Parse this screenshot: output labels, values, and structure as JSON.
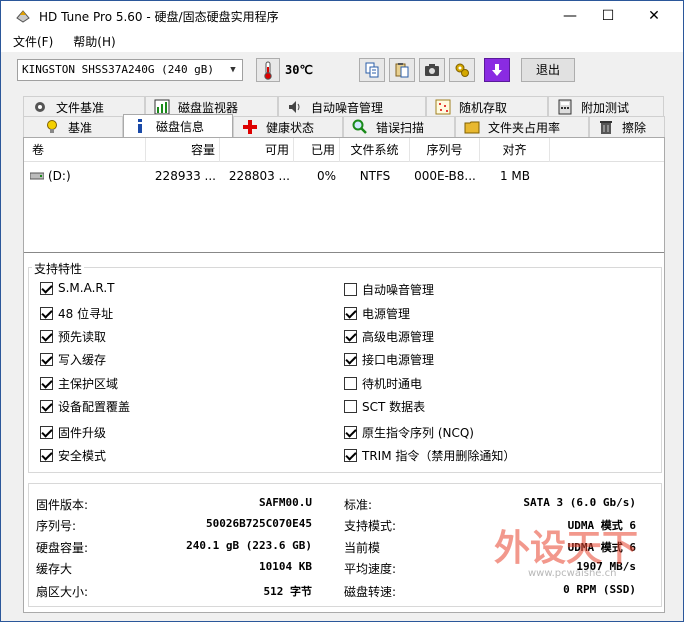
{
  "window": {
    "title": "HD Tune Pro 5.60 - 硬盘/固态硬盘实用程序",
    "minimize": "—",
    "maximize": "☐",
    "close": "✕"
  },
  "menu": {
    "file": "文件(F)",
    "help": "帮助(H)"
  },
  "toolbar": {
    "drive": "KINGSTON SHSS37A240G (240 gB)",
    "temperature": "30℃",
    "exit_label": "退出",
    "accent_color": "#8a2be2"
  },
  "tabs_top": [
    "文件基准",
    "磁盘监视器",
    "自动噪音管理",
    "随机存取",
    "附加测试"
  ],
  "tabs_bottom": [
    "基准",
    "磁盘信息",
    "健康状态",
    "错误扫描",
    "文件夹占用率",
    "擦除"
  ],
  "volumes": {
    "headers": [
      "卷",
      "容量",
      "可用",
      "已用",
      "文件系统",
      "序列号",
      "对齐"
    ],
    "rows": [
      {
        "vol": "(D:)",
        "capacity": "228933 ...",
        "free": "228803 ...",
        "used": "0%",
        "fs": "NTFS",
        "serial": "000E-B8...",
        "align": "1 MB"
      }
    ]
  },
  "features": {
    "title": "支持特性",
    "left": [
      {
        "label": "S.M.A.R.T",
        "checked": true
      },
      {
        "label": "48 位寻址",
        "checked": true
      },
      {
        "label": "预先读取",
        "checked": true
      },
      {
        "label": "写入缓存",
        "checked": true
      },
      {
        "label": "主保护区域",
        "checked": true
      },
      {
        "label": "设备配置覆盖",
        "checked": true
      },
      {
        "label": "固件升级",
        "checked": true
      },
      {
        "label": "安全模式",
        "checked": true
      }
    ],
    "right": [
      {
        "label": "自动噪音管理",
        "checked": false
      },
      {
        "label": "电源管理",
        "checked": true
      },
      {
        "label": "高级电源管理",
        "checked": true
      },
      {
        "label": "接口电源管理",
        "checked": true
      },
      {
        "label": "待机时通电",
        "checked": false
      },
      {
        "label": "SCT 数据表",
        "checked": false
      },
      {
        "label": "原生指令序列 (NCQ)",
        "checked": true
      },
      {
        "label": "TRIM 指令（禁用删除通知）",
        "checked": true
      }
    ]
  },
  "info": {
    "left": [
      {
        "label": "固件版本:",
        "value": "SAFM00.U"
      },
      {
        "label": "序列号:",
        "value": "50026B725C070E45"
      },
      {
        "label": "硬盘容量:",
        "value": "240.1 gB (223.6 GB)"
      },
      {
        "label": "缓存大",
        "value": "10104 KB"
      },
      {
        "label": "扇区大小:",
        "value": "512 字节"
      }
    ],
    "right": [
      {
        "label": "标准:",
        "value": "SATA 3 (6.0 Gb/s)"
      },
      {
        "label": "支持模式:",
        "value": "UDMA 模式 6"
      },
      {
        "label": "当前模",
        "value": "UDMA 模式 6"
      },
      {
        "label": "平均速度:",
        "value": "1907 MB/s"
      },
      {
        "label": "磁盘转速:",
        "value": "0 RPM (SSD)"
      }
    ]
  },
  "watermark": {
    "text": "外设天下",
    "url": "www.pcwaishe.cn"
  }
}
